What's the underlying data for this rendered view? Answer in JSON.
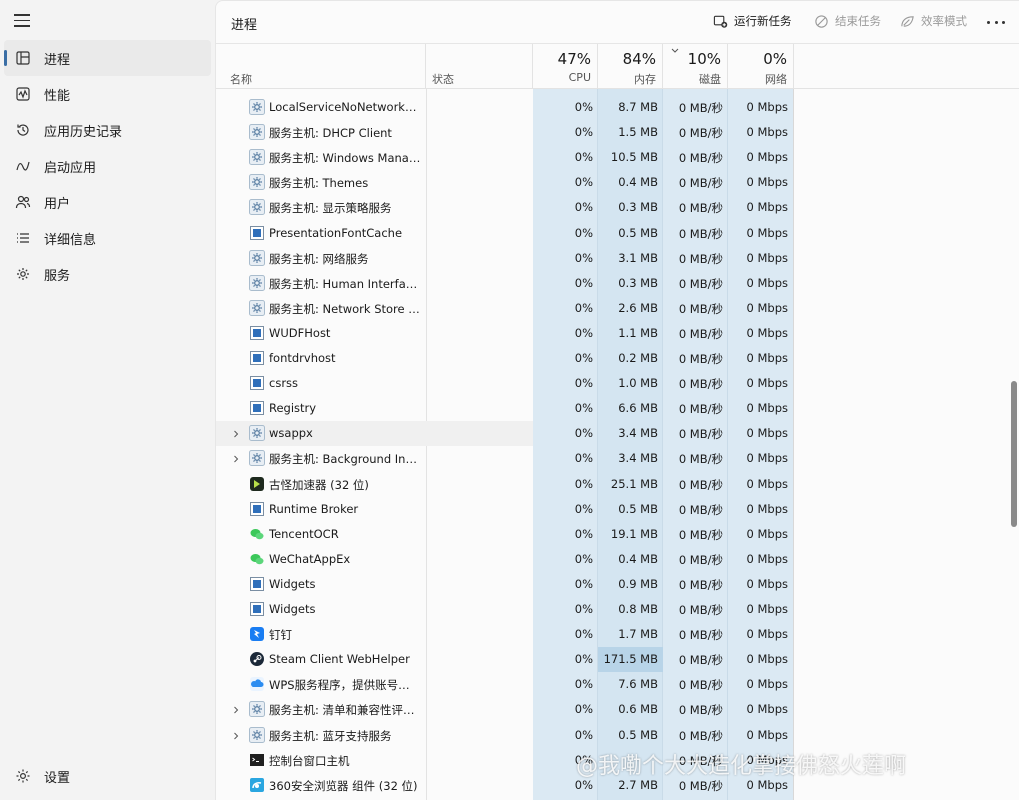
{
  "sidebar": {
    "items": [
      {
        "label": "进程",
        "icon": "processes-icon",
        "active": true
      },
      {
        "label": "性能",
        "icon": "performance-icon"
      },
      {
        "label": "应用历史记录",
        "icon": "app-history-icon"
      },
      {
        "label": "启动应用",
        "icon": "startup-apps-icon"
      },
      {
        "label": "用户",
        "icon": "users-icon"
      },
      {
        "label": "详细信息",
        "icon": "details-icon"
      },
      {
        "label": "服务",
        "icon": "services-icon"
      }
    ],
    "settings_label": "设置"
  },
  "toolbar": {
    "title": "进程",
    "run_new_task": "运行新任务",
    "end_task": "结束任务",
    "efficiency_mode": "效率模式"
  },
  "columns": {
    "name": "名称",
    "status": "状态",
    "cpu": {
      "pct": "47%",
      "label": "CPU"
    },
    "memory": {
      "pct": "84%",
      "label": "内存"
    },
    "disk": {
      "pct": "10%",
      "label": "磁盘"
    },
    "network": {
      "pct": "0%",
      "label": "网络"
    }
  },
  "processes": [
    {
      "name": "LocalServiceNoNetworkFire...",
      "icon": "service-gear-icon",
      "cpu": "0%",
      "mem": "8.7 MB",
      "disk": "0 MB/秒",
      "net": "0 Mbps"
    },
    {
      "name": "服务主机: DHCP Client",
      "icon": "service-gear-icon",
      "cpu": "0%",
      "mem": "1.5 MB",
      "disk": "0 MB/秒",
      "net": "0 Mbps"
    },
    {
      "name": "服务主机: Windows Manage...",
      "icon": "service-gear-icon",
      "cpu": "0%",
      "mem": "10.5 MB",
      "disk": "0 MB/秒",
      "net": "0 Mbps"
    },
    {
      "name": "服务主机: Themes",
      "icon": "service-gear-icon",
      "cpu": "0%",
      "mem": "0.4 MB",
      "disk": "0 MB/秒",
      "net": "0 Mbps"
    },
    {
      "name": "服务主机: 显示策略服务",
      "icon": "service-gear-icon",
      "cpu": "0%",
      "mem": "0.3 MB",
      "disk": "0 MB/秒",
      "net": "0 Mbps"
    },
    {
      "name": "PresentationFontCache",
      "icon": "window-app-icon",
      "cpu": "0%",
      "mem": "0.5 MB",
      "disk": "0 MB/秒",
      "net": "0 Mbps"
    },
    {
      "name": "服务主机: 网络服务",
      "icon": "service-gear-icon",
      "cpu": "0%",
      "mem": "3.1 MB",
      "disk": "0 MB/秒",
      "net": "0 Mbps"
    },
    {
      "name": "服务主机: Human Interface ...",
      "icon": "service-gear-icon",
      "cpu": "0%",
      "mem": "0.3 MB",
      "disk": "0 MB/秒",
      "net": "0 Mbps"
    },
    {
      "name": "服务主机: Network Store Int...",
      "icon": "service-gear-icon",
      "cpu": "0%",
      "mem": "2.6 MB",
      "disk": "0 MB/秒",
      "net": "0 Mbps"
    },
    {
      "name": "WUDFHost",
      "icon": "window-app-icon",
      "cpu": "0%",
      "mem": "1.1 MB",
      "disk": "0 MB/秒",
      "net": "0 Mbps"
    },
    {
      "name": "fontdrvhost",
      "icon": "window-app-icon",
      "cpu": "0%",
      "mem": "0.2 MB",
      "disk": "0 MB/秒",
      "net": "0 Mbps"
    },
    {
      "name": "csrss",
      "icon": "window-app-icon",
      "cpu": "0%",
      "mem": "1.0 MB",
      "disk": "0 MB/秒",
      "net": "0 Mbps"
    },
    {
      "name": "Registry",
      "icon": "window-app-icon",
      "cpu": "0%",
      "mem": "6.6 MB",
      "disk": "0 MB/秒",
      "net": "0 Mbps"
    },
    {
      "name": "wsappx",
      "icon": "service-gear-icon",
      "expandable": true,
      "hover": true,
      "cpu": "0%",
      "mem": "3.4 MB",
      "disk": "0 MB/秒",
      "net": "0 Mbps"
    },
    {
      "name": "服务主机: Background Intelli...",
      "icon": "service-gear-icon",
      "expandable": true,
      "cpu": "0%",
      "mem": "3.4 MB",
      "disk": "0 MB/秒",
      "net": "0 Mbps"
    },
    {
      "name": "古怪加速器 (32 位)",
      "icon": "accelerator-app-icon",
      "cpu": "0%",
      "mem": "25.1 MB",
      "disk": "0 MB/秒",
      "net": "0 Mbps"
    },
    {
      "name": "Runtime Broker",
      "icon": "window-app-icon",
      "cpu": "0%",
      "mem": "0.5 MB",
      "disk": "0 MB/秒",
      "net": "0 Mbps"
    },
    {
      "name": "TencentOCR",
      "icon": "wechat-icon",
      "cpu": "0%",
      "mem": "19.1 MB",
      "disk": "0 MB/秒",
      "net": "0 Mbps"
    },
    {
      "name": "WeChatAppEx",
      "icon": "wechat-icon",
      "cpu": "0%",
      "mem": "0.4 MB",
      "disk": "0 MB/秒",
      "net": "0 Mbps"
    },
    {
      "name": "Widgets",
      "icon": "window-app-icon",
      "cpu": "0%",
      "mem": "0.9 MB",
      "disk": "0 MB/秒",
      "net": "0 Mbps"
    },
    {
      "name": "Widgets",
      "icon": "window-app-icon",
      "cpu": "0%",
      "mem": "0.8 MB",
      "disk": "0 MB/秒",
      "net": "0 Mbps"
    },
    {
      "name": "钉钉",
      "icon": "dingtalk-icon",
      "cpu": "0%",
      "mem": "1.7 MB",
      "disk": "0 MB/秒",
      "net": "0 Mbps"
    },
    {
      "name": "Steam Client WebHelper",
      "icon": "steam-icon",
      "mem_highlight": true,
      "cpu": "0%",
      "mem": "171.5 MB",
      "disk": "0 MB/秒",
      "net": "0 Mbps"
    },
    {
      "name": "WPS服务程序，提供账号登录...",
      "icon": "wps-cloud-icon",
      "cpu": "0%",
      "mem": "7.6 MB",
      "disk": "0 MB/秒",
      "net": "0 Mbps"
    },
    {
      "name": "服务主机: 清单和兼容性评估...",
      "icon": "service-gear-icon",
      "expandable": true,
      "cpu": "0%",
      "mem": "0.6 MB",
      "disk": "0 MB/秒",
      "net": "0 Mbps"
    },
    {
      "name": "服务主机: 蓝牙支持服务",
      "icon": "service-gear-icon",
      "expandable": true,
      "cpu": "0%",
      "mem": "0.5 MB",
      "disk": "0 MB/秒",
      "net": "0 Mbps"
    },
    {
      "name": "控制台窗口主机",
      "icon": "console-icon",
      "cpu": "0%",
      "mem": "",
      "disk": "0 MB/秒",
      "net": "0 Mbps"
    },
    {
      "name": "360安全浏览器 组件 (32 位)",
      "icon": "browser-360-icon",
      "cpu": "0%",
      "mem": "2.7 MB",
      "disk": "0 MB/秒",
      "net": "0 Mbps"
    }
  ],
  "watermark": "@我嘞个大大造化掌接佛怒火莲啊",
  "colors": {
    "accent": "#3a6ea5",
    "cpu_col": "#dbe9f3",
    "mem_col": "#d4e5f1",
    "mem_highlight": "#b8d4e8"
  }
}
